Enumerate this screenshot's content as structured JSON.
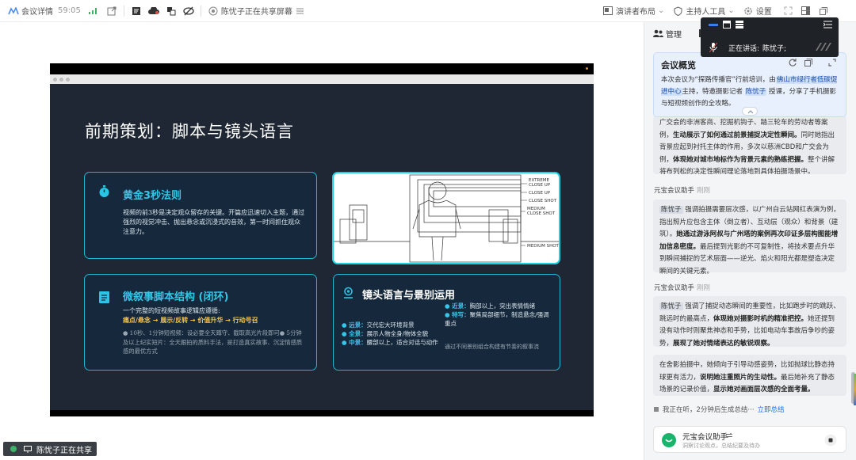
{
  "topbar": {
    "meeting_details": "会议详情",
    "timer": "59:05",
    "sharing_text": "陈忧子正在共享屏幕",
    "presenter_layout": "演讲者布局",
    "host_manual": "主持人工具",
    "settings": "设置"
  },
  "slide": {
    "title": "前期策划：脚本与镜头语言",
    "card_a": {
      "heading": "黄金3秒法则",
      "body": "视频的前3秒是决定观众留存的关键。开篇应迅速切入主题，通过强烈的视觉冲击、抛出悬念或沉浸式的音效，第一时间抓住观众注意力。"
    },
    "card_b": {
      "labels": [
        "EXTREME CLOSE UP",
        "CLOSE UP",
        "CLOSE SHOT",
        "MEDIUM CLOSE SHOT",
        "MEDIUM SHOT"
      ]
    },
    "card_c": {
      "heading": "微叙事脚本结构 (闭环)",
      "intro": "一个完整的短视频故事逻辑应遵循:",
      "flow": "痛点/悬念 → 展示/反转 → 价值升华 → 行动号召",
      "bullet": "● 10秒、1分钟短视频：设必要全天蹲守、截取高光片段即可● 5分钟及以上纪实短片：全天跟拍的质料手法，是打造真实故事、沉淀情感质感的最优方式"
    },
    "card_d": {
      "heading": "镜头语言与景别运用",
      "far_label": "● 远景：",
      "far_text": "交代宏大环境背景",
      "full_label": "● 全景：",
      "full_text": "展示人物全身/物体全貌",
      "mid_label": "● 中景：",
      "mid_text": "腰部以上，适合对话与动作",
      "close_label": "● 近景：",
      "close_text": "胸部以上，突出表情情绪",
      "detail_label": "● 特写：",
      "detail_text": "聚焦局部细节，制造悬念/强调重点",
      "footnote": "通过不同景别组合构建有节奏的叙事流"
    }
  },
  "share_badge": "陈忧子正在共享",
  "panel": {
    "tab_manage": "管理",
    "speaking_label": "正在讲话:",
    "speaking_name": "陈忧子;",
    "overview_title": "会议概览",
    "overview_pre": "本次会议为“探路传播官”行前培训，由",
    "overview_org": "佛山市绿行者低碳促进中心",
    "overview_mid": "主持，特邀摄影记者",
    "overview_name": "陈忧子",
    "overview_post": "授课，分享了手机摄影与短视频创作的全攻略。",
    "msg1_pre": "广交会的非洲客商、挖掘机钩子、踏三轮车的劳动者等案例，",
    "msg1_b1": "生动展示了如何通过前景捕捉决定性瞬间。",
    "msg1_mid": "同时她指出背景应起到衬托主体的作用，多次以慈洲CBD和广交会为例，",
    "msg1_b2": "体现她对城市地标作为背景元素的熟练把握。",
    "msg1_post": "整个讲解将布列松的决定性瞬间理论落地到具体拍摄场景中。",
    "assistant_name": "元宝会议助手",
    "just_now": "刚刚",
    "msg2_name": "陈忧子",
    "msg2_pre": "强调拍摄需要层次感，以广州白云站网红表演为例，指出照片应包含主体（倒立者）、互动层（观众）和背景（建筑）。",
    "msg2_b1": "她通过游泳阿叔与广州塔的案例再次印证多层构图能增加信息密度。",
    "msg2_mid": "最后提到光影的不可复制性，将技术要点升华到瞬间捕捉的艺术层面——逆光、焰火和阳光都是塑造决定瞬间的关键元素。",
    "msg3_name": "陈忧子",
    "msg3_pre": "强调了捕捉动态瞬间的重要性，比如跑步时的跳跃、跳远时的最高点，",
    "msg3_b1": "体现她对摄影时机的精准把控。",
    "msg3_mid": "她还提到没有动作时则聚焦神态和手势，比如电动车事故后争吵的姿势，",
    "msg3_b2": "展现了她对情绪表达的敏锐观察。",
    "msg4_pre": "在舍影拍摄中，她倾向于引导动感姿势，比如抛球比静态持球更有活力，",
    "msg4_b1": "说明她注重照片的生动性。",
    "msg4_mid": "最后她补充了静态场景的记录价值，",
    "msg4_b2": "显示她对画面层次感的全面考量。",
    "status_text": "我正在听，2分钟后生成总结···",
    "status_link": "立即总结",
    "bottom_title": "元宝会议助手",
    "bottom_sub": "洞察讨论观点，总结纪要及待办"
  }
}
